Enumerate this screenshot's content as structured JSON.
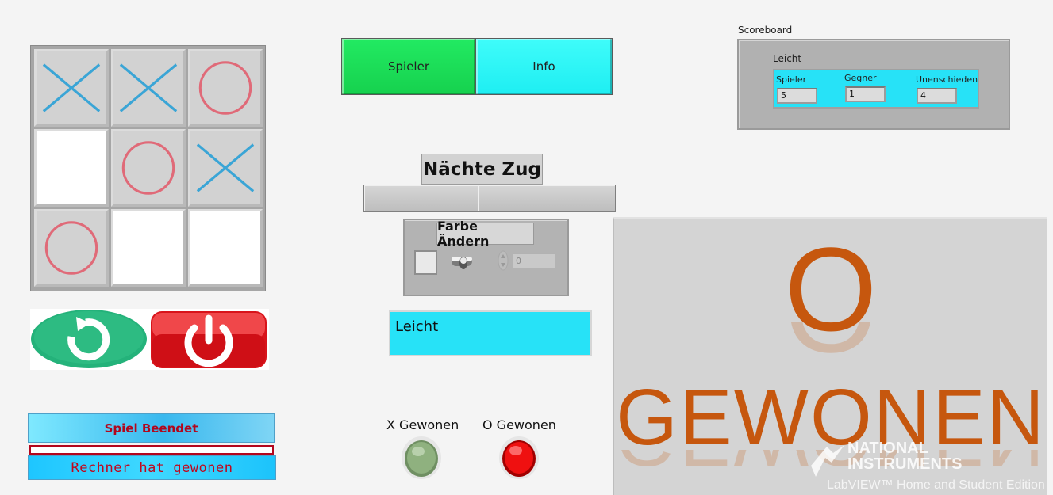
{
  "board": {
    "cells": [
      "X",
      "X",
      "O",
      "",
      "O",
      "X",
      "O",
      "",
      ""
    ]
  },
  "buttons": {
    "spieler": "Spieler",
    "info": "Info"
  },
  "scoreboard": {
    "title": "Scoreboard",
    "mode": "Leicht",
    "columns": [
      {
        "label": "Spieler",
        "value": "5"
      },
      {
        "label": "Gegner",
        "value": "1"
      },
      {
        "label": "Unenschieden",
        "value": "4"
      }
    ]
  },
  "next_move": {
    "label": "Nächte Zug"
  },
  "color_change": {
    "label": "Farbe Ändern",
    "numeric_value": "0"
  },
  "difficulty_display": "Leicht",
  "status": {
    "game_ended": "Spiel Beendet",
    "message": "Rechner hat gewonen"
  },
  "leds": {
    "x_won_label": "X Gewonen",
    "o_won_label": "O Gewonen",
    "x_won": false,
    "o_won": true
  },
  "result": {
    "winner": "O",
    "text": "GEWONEN"
  },
  "watermark": {
    "line1": "NATIONAL",
    "line2": "INSTRUMENTS",
    "edition": "LabVIEW™ Home and Student Edition"
  },
  "colors": {
    "spieler_green": "#1ee05a",
    "info_cyan": "#2af7f6",
    "cyan_display": "#27e2f7",
    "result_orange": "#c6570e",
    "x_stroke": "#3aa5d6",
    "o_stroke": "#e06a78"
  }
}
